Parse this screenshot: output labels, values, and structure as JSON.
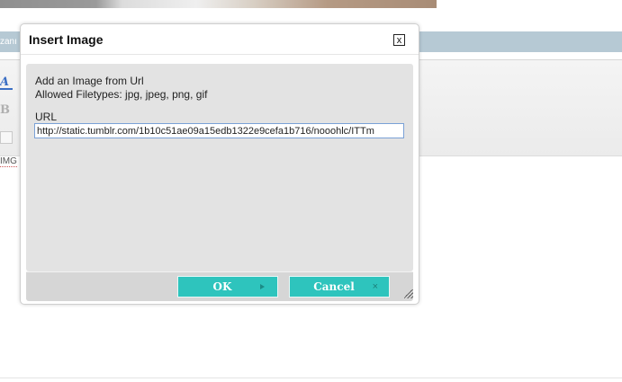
{
  "background": {
    "breadcrumb": "zanı",
    "image_tag": "IMG"
  },
  "dialog": {
    "title": "Insert Image",
    "close_label": "x",
    "intro": "Add an Image from Url",
    "filetypes": "Allowed Filetypes: jpg, jpeg, png, gif",
    "url_label": "URL",
    "url_value": "http://static.tumblr.com/1b10c51ae09a15edb1322e9cefa1b716/nooohlc/ITTm",
    "ok_label": "OK",
    "cancel_label": "Cancel",
    "cancel_icon": "×"
  },
  "colors": {
    "button": "#2ec4bd",
    "title_bar": "#b6c9d4",
    "input_border": "#7aa1d6"
  }
}
